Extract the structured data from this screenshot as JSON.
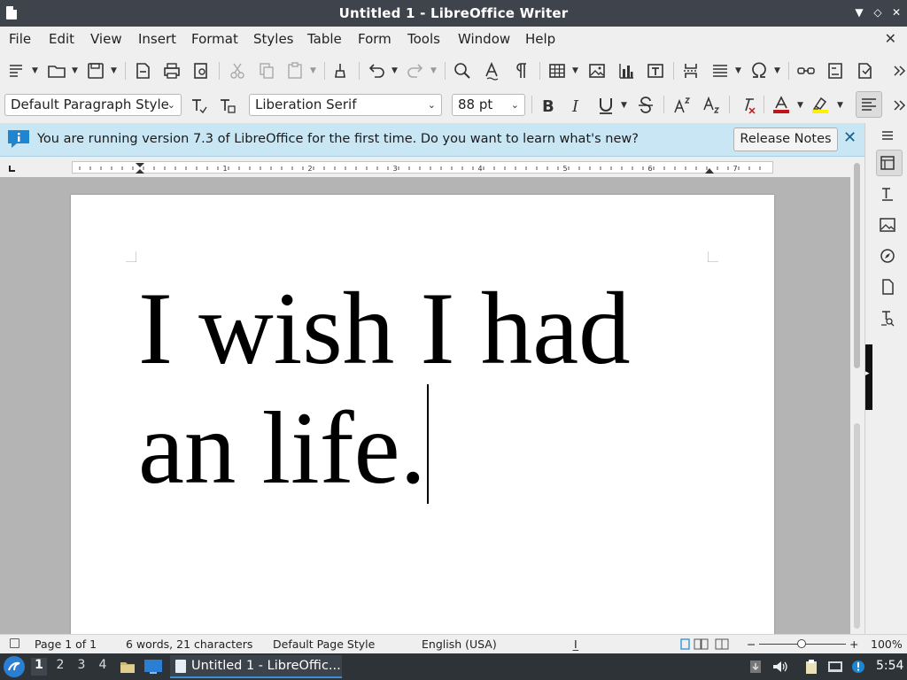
{
  "window": {
    "title": "Untitled 1 - LibreOffice Writer",
    "minimize_glyph": "▼",
    "maximize_glyph": "◇",
    "close_glyph": "✕"
  },
  "menubar": {
    "items": [
      "File",
      "Edit",
      "View",
      "Insert",
      "Format",
      "Styles",
      "Table",
      "Form",
      "Tools",
      "Window",
      "Help"
    ],
    "close_glyph": "✕"
  },
  "formatting": {
    "paragraph_style": "Default Paragraph Style",
    "font_name": "Liberation Serif",
    "font_size": "88 pt",
    "font_color": "#c0151a",
    "highlight_color": "#ffef00",
    "align_active": "align-left"
  },
  "infobar": {
    "message": "You are running version 7.3 of LibreOffice for the first time. Do you want to learn what's new?",
    "button_label": "Release Notes",
    "close_glyph": "✕"
  },
  "ruler": {
    "labels": [
      "1",
      "1",
      "2",
      "3",
      "4",
      "5",
      "6",
      "7"
    ]
  },
  "document": {
    "line1": "I wish I had",
    "line2": "an life."
  },
  "statusbar": {
    "page": "Page 1 of 1",
    "word_count": "6 words, 21 characters",
    "page_style": "Default Page Style",
    "language": "English (USA)",
    "selection_mode_glyph": "I̲",
    "zoom_minus": "−",
    "zoom_plus": "+",
    "zoom": "100%"
  },
  "taskbar": {
    "workspaces": [
      "1",
      "2",
      "3",
      "4"
    ],
    "active_workspace": "1",
    "task_label": "Untitled 1 - LibreOffic...",
    "clock": "5:54"
  }
}
